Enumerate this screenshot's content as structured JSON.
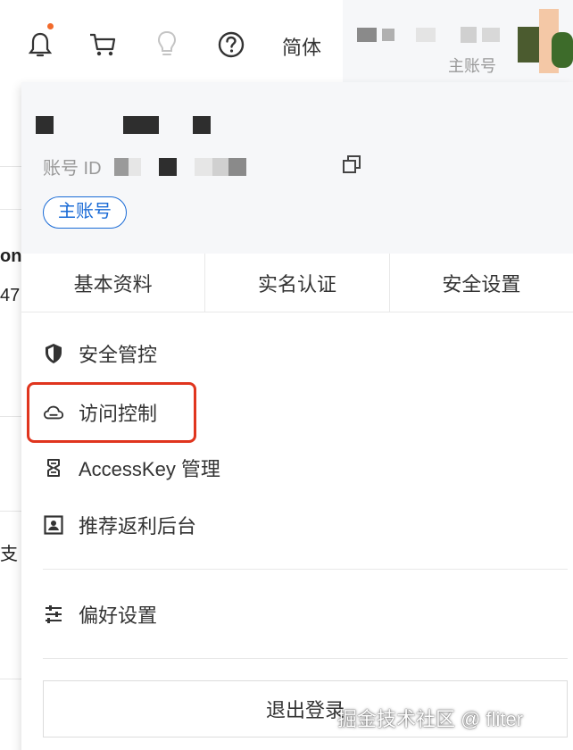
{
  "topbar": {
    "icons": [
      "bell-icon",
      "cart-icon",
      "lightbulb-icon",
      "help-icon"
    ],
    "language": "简体",
    "account_role": "主账号",
    "notification_dot_color": "#f26a2b"
  },
  "background_page": {
    "fragment_1": "on",
    "fragment_2": "47",
    "fragment_3": "支"
  },
  "account_panel": {
    "id_label": "账号 ID",
    "role_badge": "主账号",
    "tabs": [
      "基本资料",
      "实名认证",
      "安全设置"
    ],
    "menu": [
      {
        "label": "安全管控",
        "icon": "shield-icon"
      },
      {
        "label": "访问控制",
        "icon": "cloud-icon",
        "highlighted": true
      },
      {
        "label": "AccessKey 管理",
        "icon": "key-icon"
      },
      {
        "label": "推荐返利后台",
        "icon": "rebate-icon"
      },
      {
        "label": "偏好设置",
        "icon": "sliders-icon"
      }
    ],
    "logout": "退出登录"
  },
  "watermark": "掘金技术社区 @ fliter",
  "colors": {
    "accent_blue": "#1a6bd6",
    "highlight_red": "#e0351e",
    "panel_header_bg": "#f6f7f9"
  }
}
